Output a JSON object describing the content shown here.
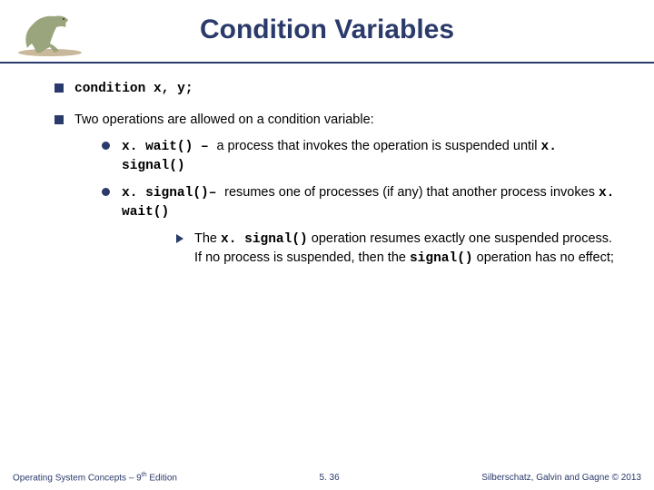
{
  "title": "Condition Variables",
  "bullets": {
    "b1a_code": "condition x, y;",
    "b1b": "Two operations are allowed on a condition variable:",
    "b2a_code": "x. wait()",
    "b2a_dash": " – ",
    "b2a_rest1": "a process that invokes the operation is suspended until ",
    "b2a_code2": "x. signal()",
    "b2b_code": "x. signal()",
    "b2b_dash": "– ",
    "b2b_rest1": "resumes one of processes (if any) that another process invokes ",
    "b2b_code2": "x. wait()",
    "b3_pre": "The ",
    "b3_code1": "x. signal()",
    "b3_mid": " operation resumes exactly one suspended process. If no process is suspended, then the ",
    "b3_code2": "signal()",
    "b3_end": " operation has no effect;"
  },
  "footer": {
    "left_pre": "Operating System Concepts – 9",
    "left_sup": "th",
    "left_post": " Edition",
    "center": "5. 36",
    "right": "Silberschatz, Galvin and Gagne © 2013"
  }
}
